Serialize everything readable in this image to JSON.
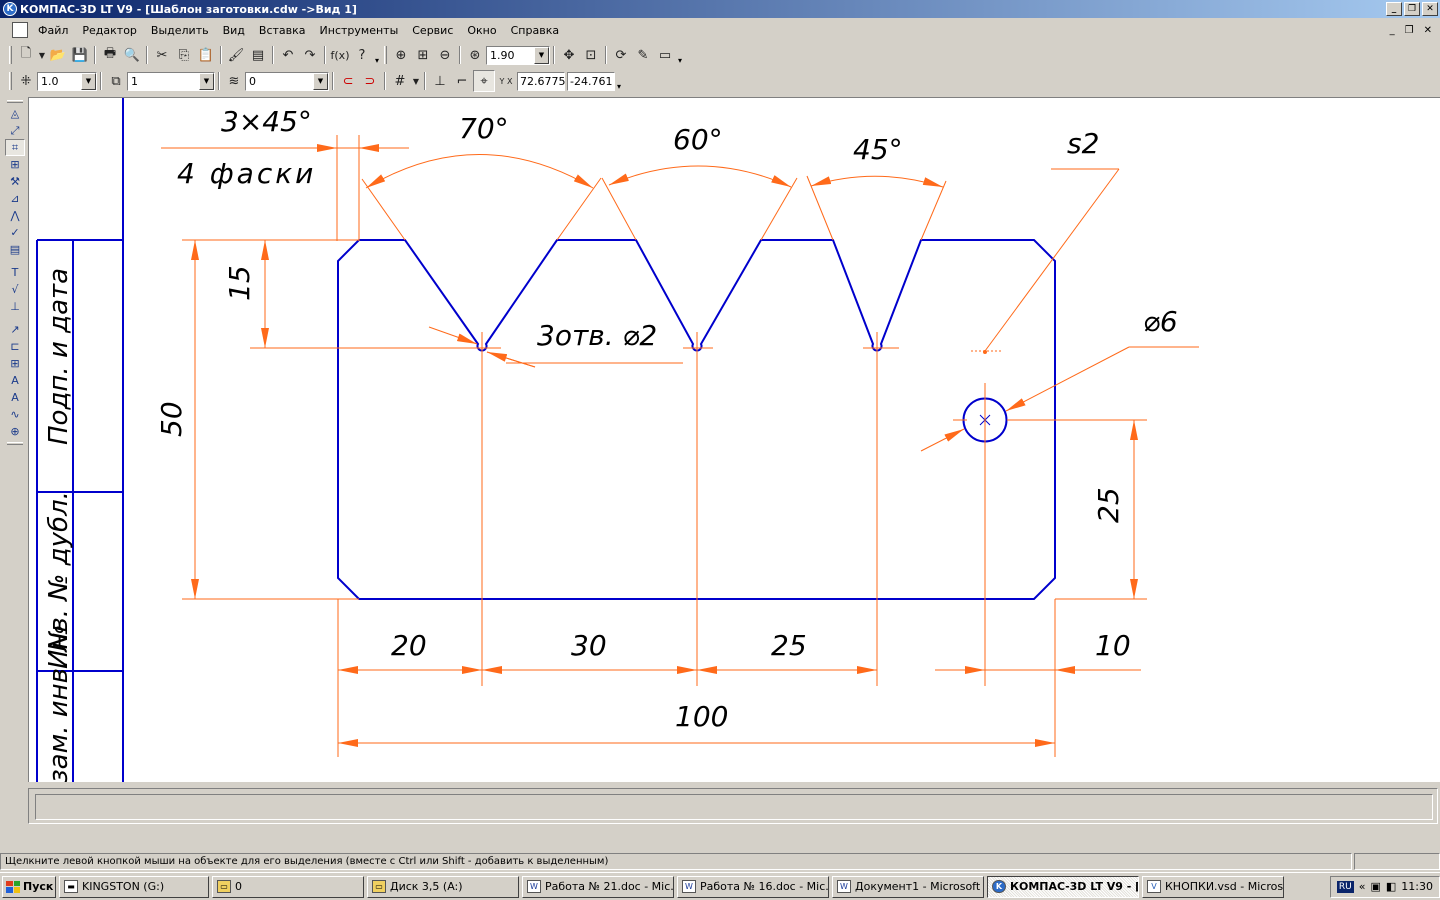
{
  "window": {
    "title": "КОМПАС-3D LT V9 - [Шаблон заготовки.cdw ->Вид 1]",
    "app_icon": "kompas-logo-icon"
  },
  "menu": {
    "items": [
      "Файл",
      "Редактор",
      "Выделить",
      "Вид",
      "Вставка",
      "Инструменты",
      "Сервис",
      "Окно",
      "Справка"
    ]
  },
  "toolbar": {
    "zoom_value": "1.90",
    "line_scale": "1.0",
    "layer_value": "1",
    "style_value": "0",
    "coord_x": "72.6775",
    "coord_y": "-24.761",
    "coord_label": "Y X"
  },
  "drawing": {
    "title_block": {
      "cell1": "Подп. и дата",
      "cell2": "Инв. № дубл.",
      "cell3": "Взам. инв. №"
    },
    "dimensions": {
      "chamfer": "3×45°",
      "chamfer_note": "4 фаски",
      "angle_1": "70°",
      "angle_2": "60°",
      "angle_3": "45°",
      "thickness": "s2",
      "holes": "3отв. ⌀2",
      "hole_dia": "⌀6",
      "depth": "15",
      "height": "50",
      "hole_height": "25",
      "d1": "20",
      "d2": "30",
      "d3": "25",
      "d4": "10",
      "total": "100"
    }
  },
  "status": {
    "message": "Щелкните левой кнопкой мыши на объекте для его выделения (вместе с Ctrl или Shift - добавить к выделенным)"
  },
  "taskbar": {
    "start_label": "Пуск",
    "tasks": [
      "KINGSTON (G:)",
      "0",
      "Диск 3,5 (A:)",
      "Работа № 21.doc - Mic...",
      "Работа № 16.doc - Mic...",
      "Документ1 - Microsoft ...",
      "КОМПАС-3D LT V9 - [...",
      "КНОПКИ.vsd - Microsof..."
    ],
    "lang": "RU",
    "clock": "11:30"
  },
  "colors": {
    "contour": "#0000cc",
    "dimension": "#ff6a1a",
    "frame": "#0000cc"
  }
}
